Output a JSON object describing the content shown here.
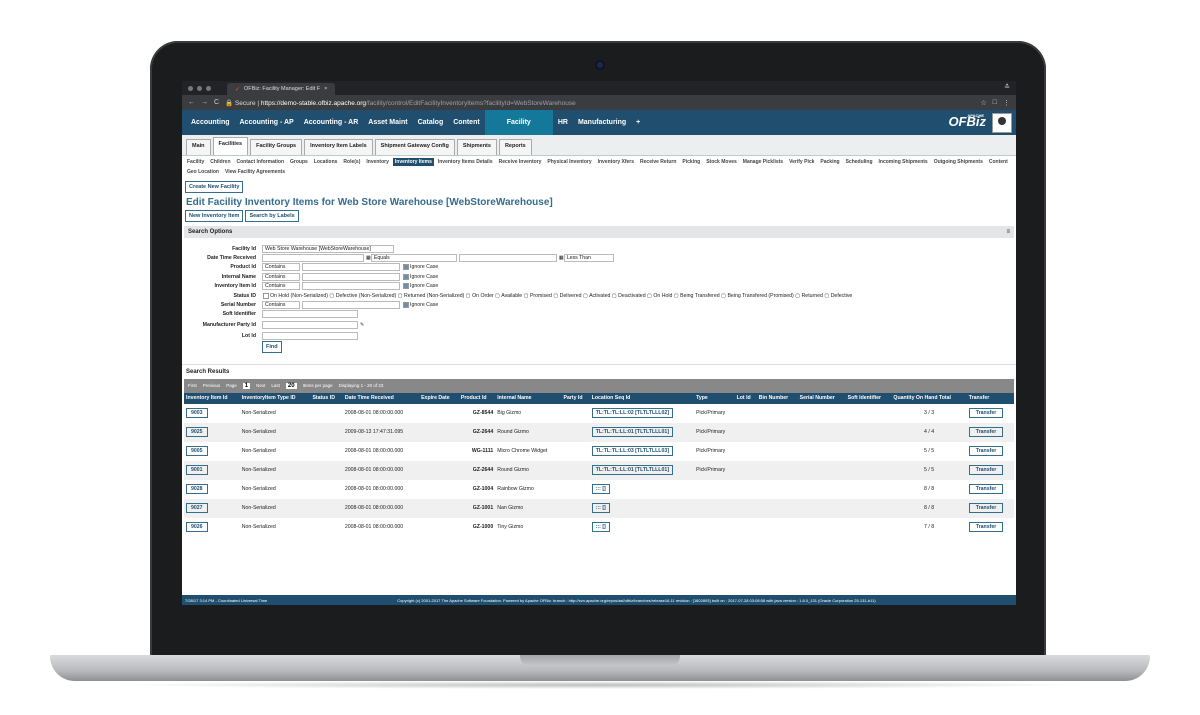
{
  "browser": {
    "tab_title": "OFBiz: Facility Manager: Edit F",
    "url_secure": "Secure",
    "url_host": "https://demo-stable.ofbiz.apache.org",
    "url_path": "/facility/control/EditFacilityInventoryItems?facilityId=WebStoreWarehouse"
  },
  "app_nav": {
    "items": [
      "Accounting",
      "Accounting - AP",
      "Accounting - AR",
      "Asset Maint",
      "Catalog",
      "Content",
      "Facility",
      "HR",
      "Manufacturing",
      "+"
    ],
    "logo": "OFBiz",
    "logo_small": "APACHE"
  },
  "subnav": [
    "Main",
    "Facilities",
    "Facility Groups",
    "Inventory Item Labels",
    "Shipment Gateway Config",
    "Shipments",
    "Reports"
  ],
  "facility_buttons": [
    "Facility",
    "Children",
    "Contact Information",
    "Groups",
    "Locations",
    "Role(s)",
    "Inventory",
    "Inventory Items",
    "Inventory Items Details",
    "Receive Inventory",
    "Physical Inventory",
    "Inventory Xfers",
    "Receive Return",
    "Picking",
    "Stock Moves",
    "Manage Picklists",
    "Verify Pick",
    "Packing",
    "Scheduling",
    "Incoming Shipments",
    "Outgoing Shipments",
    "Content",
    "Geo Location",
    "View Facility Agreements"
  ],
  "create_button": "Create New Facility",
  "page_title": "Edit Facility Inventory Items for Web Store Warehouse [WebStoreWarehouse]",
  "new_item_button": "New Inventory Item",
  "search_labels_button": "Search by Labels",
  "search_options": {
    "header": "Search Options",
    "facility_label": "Facility Id",
    "facility_value": "Web Store Warehouse [WebStoreWarehouse]",
    "date_label": "Date Time Received",
    "equals": "Equals",
    "less_than": "Less Than",
    "product_label": "Product Id",
    "internal_label": "Internal Name",
    "inv_item_label": "Inventory Item Id",
    "status_label": "Status ID",
    "serial_label": "Serial Number",
    "soft_label": "Soft Identifier",
    "mfr_label": "Manufacturer Party Id",
    "lot_label": "Lot Id",
    "contains": "Contains",
    "ignore_case": "Ignore Case",
    "statuses": "On Hold (Non-Serialized) ▢ Defective (Non-Serialized) ▢ Returned (Non-Serialized) ▢ On Order ▢ Available ▢ Promised ▢ Delivered ▢ Activated ▢ Deactivated ▢ On Hold ▢ Being Transfered ▢ Being Transfered (Promised) ▢ Returned ▢ Defective",
    "find": "Find"
  },
  "results": {
    "header": "Search Results",
    "pager_first": "First",
    "pager_prev": "Previous",
    "pager_page": "Page",
    "pager_page_num": "1",
    "pager_next": "Next",
    "pager_last": "Last",
    "pager_per_page": "20",
    "pager_items_per_page": "Items per page",
    "pager_display": "Displaying 1 - 20 of 23",
    "columns": [
      "Inventory Item Id",
      "InventoryItem Type ID",
      "Status ID",
      "Date Time Received",
      "Expire Date",
      "Product Id",
      "Internal Name",
      "Party Id",
      "Location Seq Id",
      "Type",
      "Lot Id",
      "Bin Number",
      "Serial Number",
      "Soft Identifier",
      "Quantity On Hand Total",
      "Transfer"
    ],
    "rows": [
      {
        "id": "9003",
        "type": "Non-Serialized",
        "date": "2008-08-01 08:00:00.000",
        "product": "GZ-8544",
        "name": "Big Gizmo",
        "loc": "TL:TL:TL:LL:02 [TLTLTLLL02]",
        "ltype": "Pick/Primary",
        "qty": "3 / 3",
        "xfer": "Transfer"
      },
      {
        "id": "9025",
        "type": "Non-Serialized",
        "date": "2009-08-13 17:47:31.095",
        "product": "GZ-2644",
        "name": "Round Gizmo",
        "loc": "TL:TL:TL:LL:01 [TLTLTLLL01]",
        "ltype": "Pick/Primary",
        "qty": "4 / 4",
        "xfer": "Transfer"
      },
      {
        "id": "9005",
        "type": "Non-Serialized",
        "date": "2008-08-01 08:00:00.000",
        "product": "WG-1111",
        "name": "Micro Chrome Widget",
        "loc": "TL:TL:TL:LL:03 [TLTLTLLL03]",
        "ltype": "Pick/Primary",
        "qty": "5 / 5",
        "xfer": "Transfer"
      },
      {
        "id": "9001",
        "type": "Non-Serialized",
        "date": "2008-08-01 08:00:00.000",
        "product": "GZ-2644",
        "name": "Round Gizmo",
        "loc": "TL:TL:TL:LL:01 [TLTLTLLL01]",
        "ltype": "Pick/Primary",
        "qty": "5 / 5",
        "xfer": "Transfer"
      },
      {
        "id": "9028",
        "type": "Non-Serialized",
        "date": "2008-08-01 08:00:00.000",
        "product": "GZ-1004",
        "name": "Rainbow Gizmo",
        "loc": "::: []",
        "ltype": "",
        "qty": "8 / 8",
        "xfer": "Transfer"
      },
      {
        "id": "9027",
        "type": "Non-Serialized",
        "date": "2008-08-01 08:00:00.000",
        "product": "GZ-1001",
        "name": "Nan Gizmo",
        "loc": "::: []",
        "ltype": "",
        "qty": "8 / 8",
        "xfer": "Transfer"
      },
      {
        "id": "9026",
        "type": "Non-Serialized",
        "date": "2008-08-01 08:00:00.000",
        "product": "GZ-1000",
        "name": "Tiny Gizmo",
        "loc": "::: []",
        "ltype": "",
        "qty": "7 / 8",
        "xfer": "Transfer"
      }
    ]
  },
  "footer": {
    "left": "7/28/17 3:14 PM - Coordinated Universal Time",
    "right": "Copyright (c) 2001-2017 The Apache Software Foundation. Powered by Apache OFBiz. branch : http://svn.apache.org/repos/asf/ofbiz/branches/release16.11 revision : [1802893] built on : 2017-07-28 03:08:58 with java version : 1.8.0_131 (Oracle Corporation 25.131-b11)"
  },
  "colors": {
    "nav": "#1f4e6e",
    "active": "#13789a"
  }
}
